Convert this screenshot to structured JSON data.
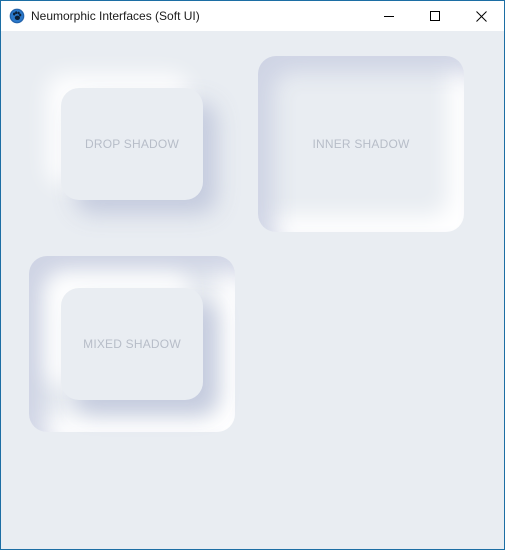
{
  "window": {
    "title": "Neumorphic Interfaces (Soft UI)",
    "app_icon": "paw-icon",
    "controls": {
      "minimize_icon": "minimize-icon",
      "maximize_icon": "maximize-icon",
      "close_icon": "close-icon"
    }
  },
  "cards": {
    "drop_shadow": {
      "label": "DROP SHADOW"
    },
    "inner_shadow": {
      "label": "INNER SHADOW"
    },
    "mixed_shadow": {
      "label": "MIXED SHADOW"
    }
  },
  "colors": {
    "background": "#e9edf2",
    "shadow_dark": "#bec6da",
    "shadow_light": "#ffffff",
    "label_text": "#b7bdc8",
    "window_border": "#1c6ea4"
  }
}
